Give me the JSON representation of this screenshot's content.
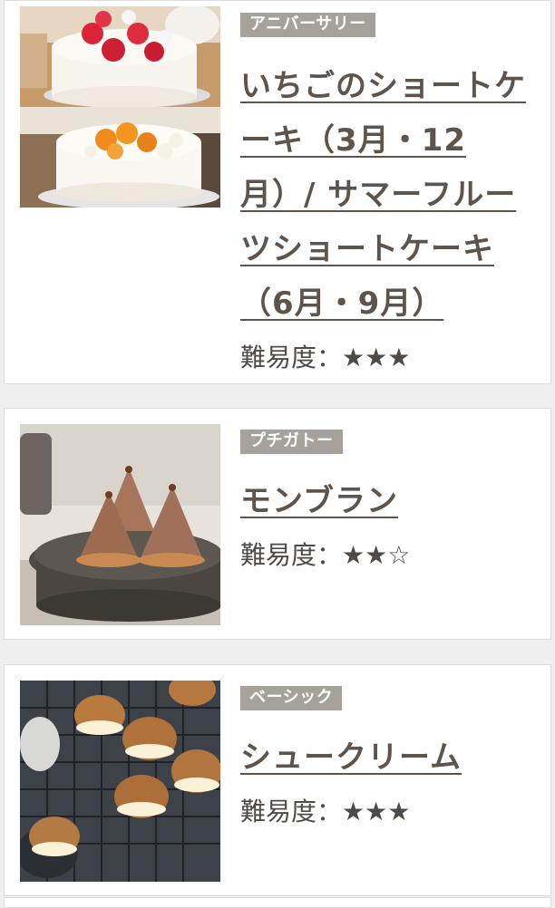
{
  "recipes": [
    {
      "category": "アニバーサリー",
      "title": "いちごのショートケーキ（3月・12月）/ サマーフルーツショートケーキ（6月・9月）",
      "difficulty_label": "難易度：",
      "difficulty_stars": "★★★",
      "image": "strawberry-and-fruit-shortcake-photo"
    },
    {
      "category": "プチガトー",
      "title": "モンブラン",
      "difficulty_label": "難易度：",
      "difficulty_stars": "★★☆",
      "image": "mont-blanc-photo"
    },
    {
      "category": "ベーシック",
      "title": "シュークリーム",
      "difficulty_label": "難易度：",
      "difficulty_stars": "★★★",
      "image": "cream-puff-photo"
    }
  ],
  "colors": {
    "tag_background": "#a6a29b",
    "title_text": "#5e544b",
    "page_background": "#efefef"
  }
}
